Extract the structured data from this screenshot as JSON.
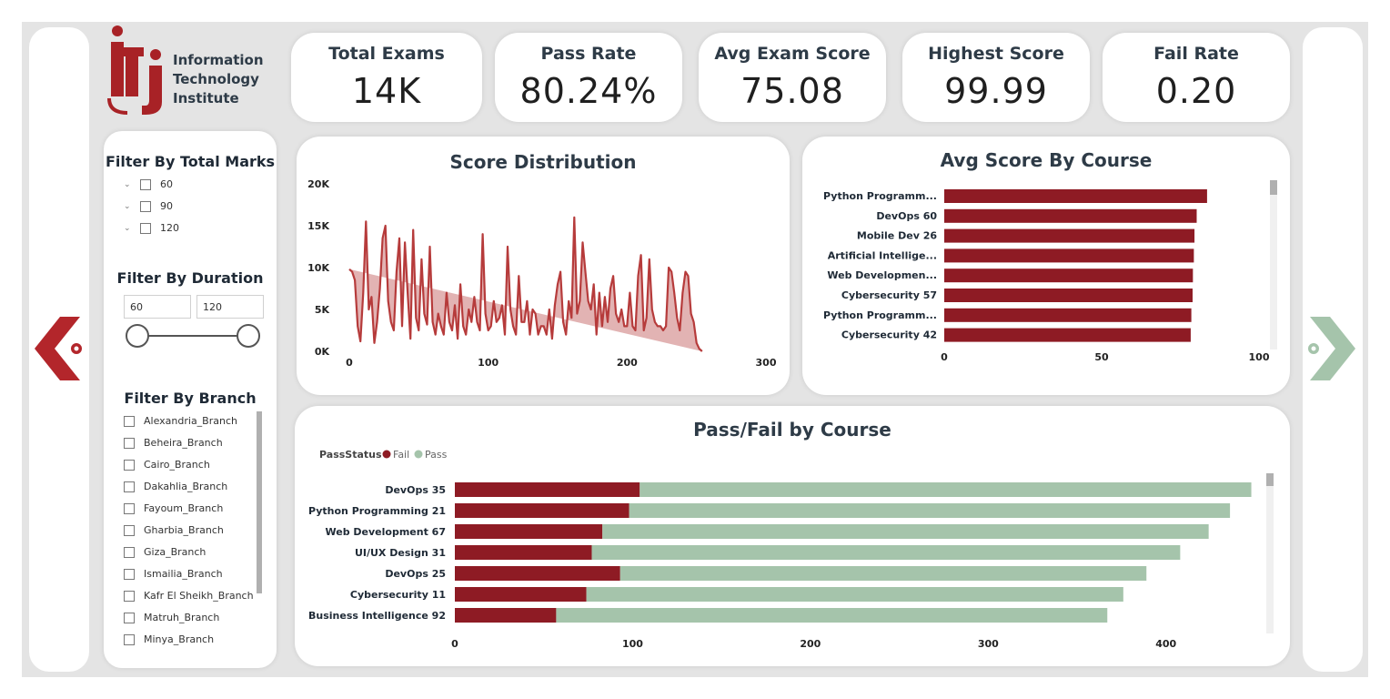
{
  "logo": {
    "text": "iTi",
    "lines": [
      "Information",
      "Technology",
      "Institute"
    ]
  },
  "kpis": [
    {
      "title": "Total Exams",
      "value": "14K"
    },
    {
      "title": "Pass Rate",
      "value": "80.24%"
    },
    {
      "title": "Avg Exam Score",
      "value": "75.08"
    },
    {
      "title": "Highest Score",
      "value": "99.99"
    },
    {
      "title": "Fail Rate",
      "value": "0.20"
    }
  ],
  "filters": {
    "marks": {
      "title": "Filter By Total Marks",
      "options": [
        "60",
        "90",
        "120"
      ]
    },
    "duration": {
      "title": "Filter By Duration",
      "min": "60",
      "max": "120"
    },
    "branch": {
      "title": "Filter By Branch",
      "options": [
        "Alexandria_Branch",
        "Beheira_Branch",
        "Cairo_Branch",
        "Dakahlia_Branch",
        "Fayoum_Branch",
        "Gharbia_Branch",
        "Giza_Branch",
        "Ismailia_Branch",
        "Kafr El Sheikh_Branch",
        "Matruh_Branch",
        "Minya_Branch"
      ]
    }
  },
  "colors": {
    "fail": "#8e1b24",
    "pass": "#a5c4ab",
    "area": "#e2b3b3",
    "line": "#b63b3b",
    "arrow_left": "#b3262b",
    "arrow_right": "#a5c4ab"
  },
  "icons": {
    "prev": "chevron-left-icon",
    "next": "chevron-right-icon"
  },
  "chart_data": [
    {
      "type": "area",
      "title": "Score Distribution",
      "xlim": [
        0,
        300
      ],
      "ylim": [
        0,
        20000
      ],
      "xticks": [
        "0",
        "100",
        "200",
        "300"
      ],
      "yticks": [
        "0K",
        "5K",
        "10K",
        "15K",
        "20K"
      ],
      "x": [
        0,
        2,
        4,
        6,
        8,
        10,
        12,
        14,
        16,
        18,
        20,
        22,
        24,
        26,
        28,
        30,
        32,
        34,
        36,
        38,
        40,
        42,
        44,
        46,
        48,
        50,
        52,
        54,
        56,
        58,
        60,
        62,
        64,
        66,
        68,
        70,
        72,
        74,
        76,
        78,
        80,
        82,
        84,
        86,
        88,
        90,
        92,
        94,
        96,
        98,
        100,
        102,
        104,
        106,
        108,
        110,
        112,
        114,
        116,
        118,
        120,
        122,
        124,
        126,
        128,
        130,
        132,
        134,
        136,
        138,
        140,
        142,
        144,
        146,
        148,
        150,
        152,
        154,
        156,
        158,
        160,
        162,
        164,
        166,
        168,
        170,
        172,
        174,
        176,
        178,
        180,
        182,
        184,
        186,
        188,
        190,
        192,
        194,
        196,
        198,
        200,
        202,
        204,
        206,
        208,
        210,
        212,
        214,
        216,
        218,
        220,
        222,
        224,
        226,
        228,
        230,
        232,
        234,
        236,
        238,
        240,
        242,
        244,
        246,
        248,
        250,
        252,
        254,
        256
      ],
      "y": [
        9800,
        9500,
        8500,
        3000,
        1200,
        7000,
        15500,
        5000,
        6500,
        1000,
        3500,
        7500,
        13500,
        15000,
        6000,
        3500,
        2500,
        9500,
        13500,
        3000,
        13000,
        7000,
        1500,
        14500,
        4000,
        2500,
        11000,
        4500,
        3200,
        12500,
        3500,
        2000,
        4500,
        3000,
        2000,
        7000,
        3500,
        2500,
        5500,
        1500,
        8000,
        3000,
        2000,
        5000,
        3500,
        6500,
        3500,
        2500,
        14000,
        4500,
        2500,
        3000,
        6000,
        3500,
        4000,
        5500,
        2000,
        12500,
        5000,
        3000,
        2000,
        9000,
        3500,
        3500,
        6000,
        2000,
        5000,
        4500,
        2000,
        3000,
        3000,
        2000,
        5000,
        1500,
        5500,
        8000,
        9500,
        3500,
        2000,
        6000,
        4000,
        16000,
        4500,
        6000,
        13000,
        9500,
        6000,
        5000,
        8000,
        2000,
        7000,
        3000,
        6500,
        3500,
        7500,
        9000,
        4500,
        3500,
        5000,
        3000,
        3000,
        7000,
        3000,
        2500,
        9000,
        11500,
        2500,
        4000,
        11000,
        5000,
        3500,
        3000,
        3000,
        2500,
        3000,
        10000,
        9500,
        7000,
        4000,
        2500,
        7000,
        9500,
        9000,
        4500,
        3500,
        1000,
        300,
        0
      ]
    },
    {
      "type": "bar",
      "title": "Avg Score By Course",
      "categories": [
        "Python Programm...",
        "DevOps 60",
        "Mobile Dev 26",
        "Artificial Intellige...",
        "Web Developmen...",
        "Cybersecurity 57",
        "Python Programm...",
        "Cybersecurity 42"
      ],
      "values": [
        83.5,
        80.2,
        79.5,
        79.3,
        79.0,
        78.9,
        78.5,
        78.3
      ],
      "xlim": [
        0,
        100
      ],
      "xticks": [
        "0",
        "50",
        "100"
      ]
    },
    {
      "type": "bar",
      "title": "Pass/Fail by Course",
      "legend_title": "PassStatus",
      "categories": [
        "DevOps 35",
        "Python Programming 21",
        "Web Development 67",
        "UI/UX Design 31",
        "DevOps 25",
        "Cybersecurity 11",
        "Business Intelligence 92"
      ],
      "series": [
        {
          "name": "Fail",
          "values": [
            104,
            98,
            83,
            77,
            93,
            74,
            57
          ]
        },
        {
          "name": "Pass",
          "values": [
            344,
            338,
            341,
            331,
            296,
            302,
            310
          ]
        }
      ],
      "xlim": [
        0,
        460
      ],
      "xticks": [
        "0",
        "100",
        "200",
        "300",
        "400"
      ],
      "legend": "top-left"
    }
  ]
}
